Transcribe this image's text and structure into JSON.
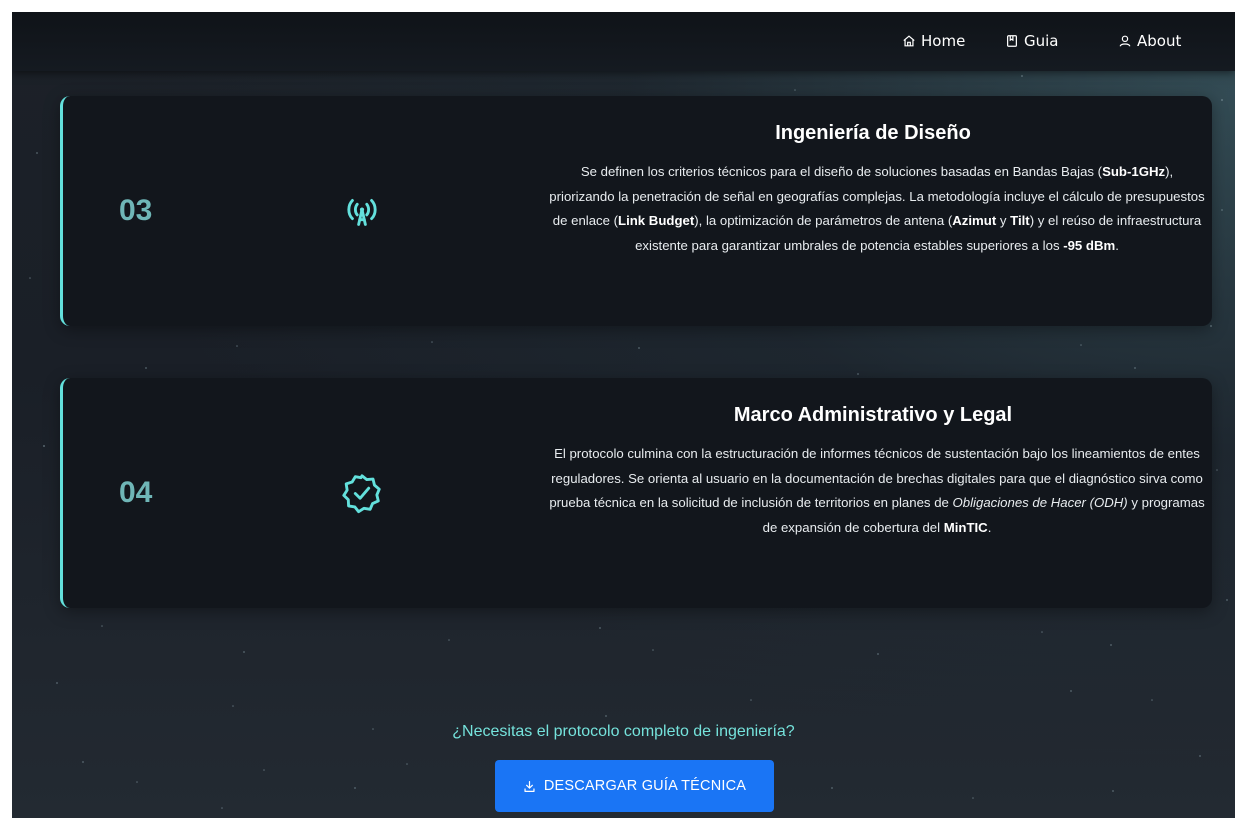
{
  "nav": {
    "items": [
      {
        "label": "Home",
        "icon": "home-icon"
      },
      {
        "label": "Guia",
        "icon": "book-icon"
      },
      {
        "label": "About",
        "icon": "user-icon"
      }
    ]
  },
  "cards": [
    {
      "number": "03",
      "icon": "antenna-icon",
      "title": "Ingeniería de Diseño",
      "body_parts": [
        "Se definen los criterios técnicos para el diseño de soluciones basadas en Bandas Bajas (",
        "Sub-1GHz",
        "), priorizando la penetración de señal en geografías complejas. La metodología incluye el cálculo de presupuestos de enlace (",
        "Link Budget",
        "), la optimización de parámetros de antena (",
        "Azimut",
        " y ",
        "Tilt",
        ") y el reúso de infraestructura existente para garantizar umbrales de potencia estables superiores a los ",
        "-95 dBm",
        "."
      ]
    },
    {
      "number": "04",
      "icon": "verified-badge-icon",
      "title": "Marco Administrativo y Legal",
      "body_parts": [
        "El protocolo culmina con la estructuración de informes técnicos de sustentación bajo los lineamientos de entes reguladores. Se orienta al usuario en la documentación de brechas digitales para que el diagnóstico sirva como prueba técnica en la solicitud de inclusión de territorios en planes de ",
        "Obligaciones de Hacer (ODH)",
        " y programas de expansión de cobertura del ",
        "MinTIC",
        "."
      ]
    }
  ],
  "cta": {
    "question": "¿Necesitas el protocolo completo de ingeniería?",
    "button_label": "DESCARGAR GUÍA TÉCNICA",
    "button_icon": "download-icon"
  },
  "colors": {
    "accent": "#63e0dc",
    "number": "#6fb6b7",
    "button": "#1a75f5",
    "card_bg": "#12161c"
  }
}
